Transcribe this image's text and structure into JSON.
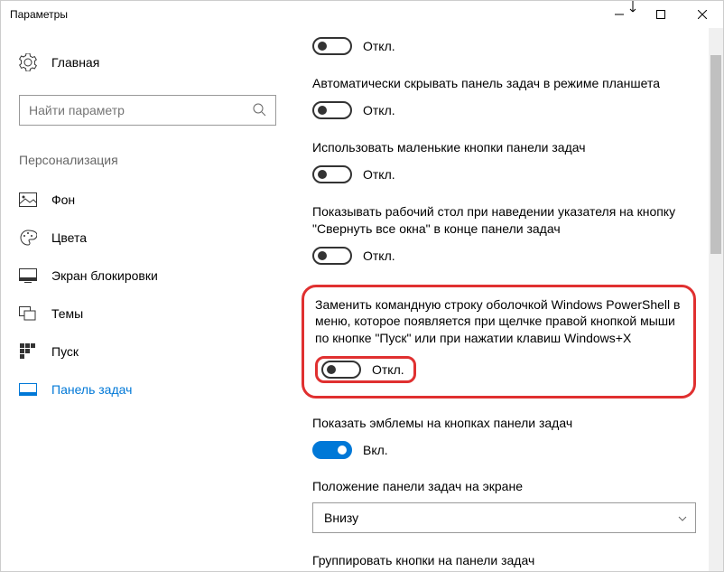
{
  "window": {
    "title": "Параметры"
  },
  "sidebar": {
    "home": "Главная",
    "search_placeholder": "Найти параметр",
    "category": "Персонализация",
    "items": [
      {
        "label": "Фон"
      },
      {
        "label": "Цвета"
      },
      {
        "label": "Экран блокировки"
      },
      {
        "label": "Темы"
      },
      {
        "label": "Пуск"
      },
      {
        "label": "Панель задач"
      }
    ]
  },
  "main": {
    "settings": [
      {
        "label": "",
        "state": "Откл."
      },
      {
        "label": "Автоматически скрывать панель задач в режиме планшета",
        "state": "Откл."
      },
      {
        "label": "Использовать маленькие кнопки панели задач",
        "state": "Откл."
      },
      {
        "label": "Показывать рабочий стол при наведении указателя на кнопку \"Свернуть все окна\" в конце панели задач",
        "state": "Откл."
      },
      {
        "label": "Заменить командную строку оболочкой Windows PowerShell в меню, которое появляется при щелчке правой кнопкой мыши по кнопке \"Пуск\" или при нажатии клавиш Windows+X",
        "state": "Откл."
      },
      {
        "label": "Показать эмблемы на кнопках панели задач",
        "state": "Вкл."
      }
    ],
    "position": {
      "label": "Положение панели задач на экране",
      "value": "Внизу"
    },
    "grouping": {
      "label": "Группировать кнопки на панели задач"
    }
  }
}
